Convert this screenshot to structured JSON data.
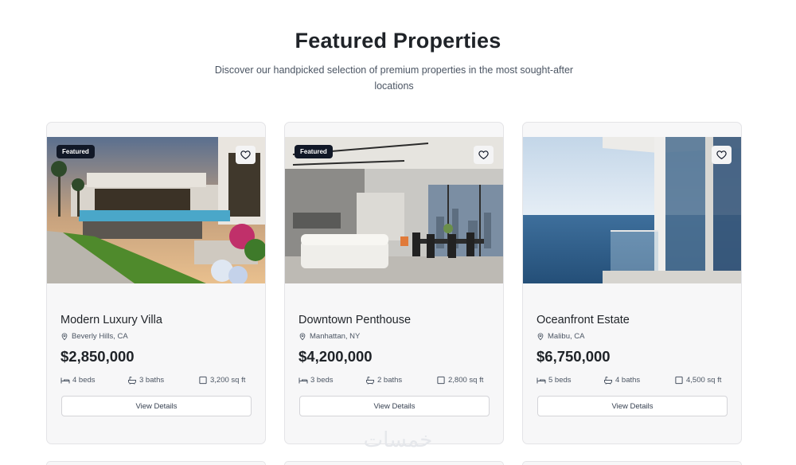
{
  "section": {
    "title": "Featured Properties",
    "subtitle": "Discover our handpicked selection of premium properties in the most sought-after locations"
  },
  "properties": [
    {
      "badge": "Featured",
      "name": "Modern Luxury Villa",
      "location": "Beverly Hills, CA",
      "price": "$2,850,000",
      "beds": "4 beds",
      "baths": "3 baths",
      "sqft": "3,200 sq ft",
      "button": "View Details"
    },
    {
      "badge": "Featured",
      "name": "Downtown Penthouse",
      "location": "Manhattan, NY",
      "price": "$4,200,000",
      "beds": "3 beds",
      "baths": "2 baths",
      "sqft": "2,800 sq ft",
      "button": "View Details"
    },
    {
      "badge": "",
      "name": "Oceanfront Estate",
      "location": "Malibu, CA",
      "price": "$6,750,000",
      "beds": "5 beds",
      "baths": "4 baths",
      "sqft": "4,500 sq ft",
      "button": "View Details"
    }
  ],
  "watermark": "خمسات",
  "icons": {
    "favorite": "heart-icon",
    "location": "map-pin-icon",
    "beds": "bed-icon",
    "baths": "bath-icon",
    "sqft": "square-icon"
  }
}
